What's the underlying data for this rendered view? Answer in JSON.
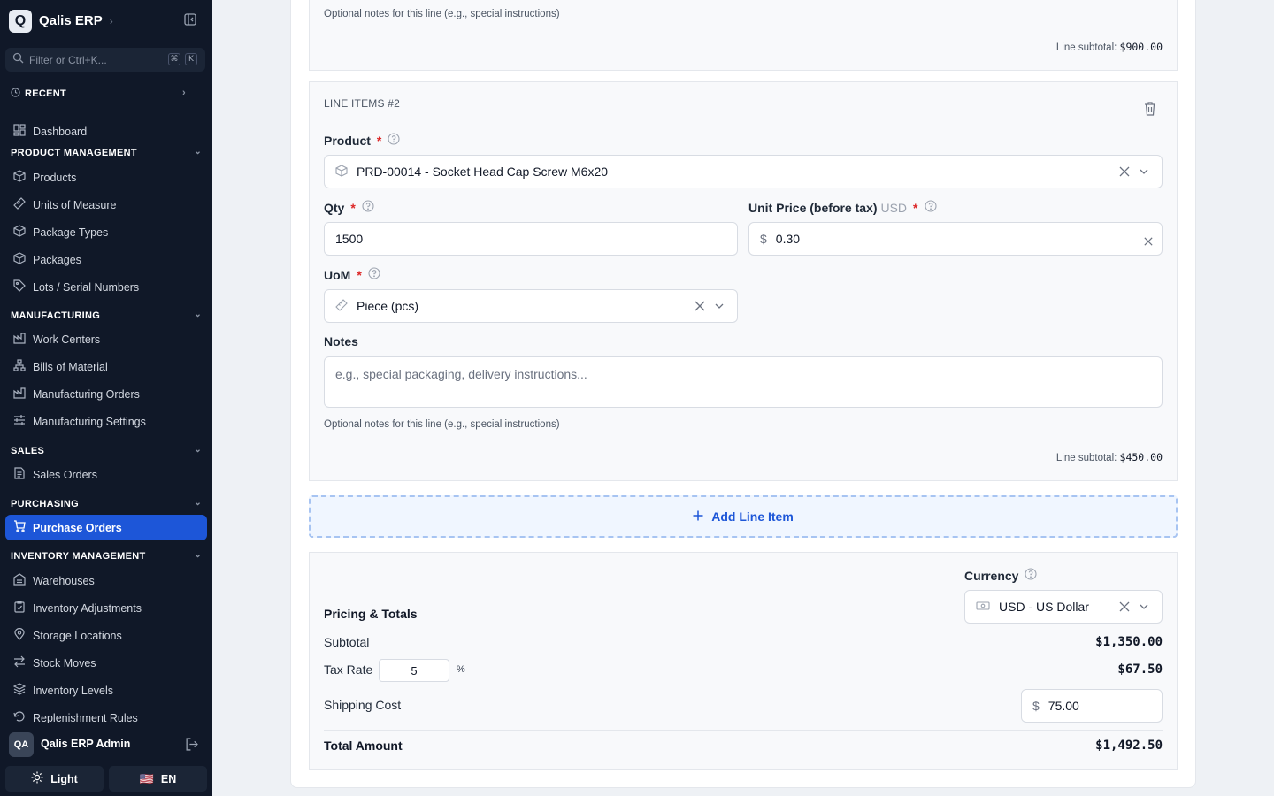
{
  "sidebar": {
    "brand": {
      "logo": "Q",
      "name": "Qalis ERP"
    },
    "filter": {
      "placeholder": "Filter or Ctrl+K...",
      "kbd_1": "⌘",
      "kbd_2": "K"
    },
    "recent_label": "RECENT",
    "dashboard": "Dashboard",
    "sections": {
      "product_management": "PRODUCT MANAGEMENT",
      "manufacturing": "MANUFACTURING",
      "sales": "SALES",
      "purchasing": "PURCHASING",
      "inventory_management": "INVENTORY MANAGEMENT"
    },
    "items": {
      "products": "Products",
      "units_of_measure": "Units of Measure",
      "package_types": "Package Types",
      "packages": "Packages",
      "lots_serial": "Lots / Serial Numbers",
      "work_centers": "Work Centers",
      "bills_of_material": "Bills of Material",
      "manufacturing_orders": "Manufacturing Orders",
      "manufacturing_settings": "Manufacturing Settings",
      "sales_orders": "Sales Orders",
      "purchase_orders": "Purchase Orders",
      "warehouses": "Warehouses",
      "inventory_adjustments": "Inventory Adjustments",
      "storage_locations": "Storage Locations",
      "stock_moves": "Stock Moves",
      "inventory_levels": "Inventory Levels",
      "replenishment_rules": "Replenishment Rules"
    },
    "user": {
      "initials": "QA",
      "name": "Qalis ERP Admin"
    },
    "theme_label": "Light",
    "language_label": "EN",
    "language_flag": "🇺🇸",
    "active_color": "#1d56d8"
  },
  "line1": {
    "notes_helper": "Optional notes for this line (e.g., special instructions)",
    "subtotal_label": "Line subtotal:",
    "subtotal_value": "$900.00"
  },
  "line2": {
    "title": "LINE ITEMS #2",
    "product_label": "Product",
    "product_value": "PRD-00014 - Socket Head Cap Screw M6x20",
    "qty_label": "Qty",
    "qty_value": "1500",
    "price_label": "Unit Price (before tax)",
    "price_currency": "USD",
    "price_symbol": "$",
    "price_value": "0.30",
    "uom_label": "UoM",
    "uom_value": "Piece (pcs)",
    "notes_label": "Notes",
    "notes_placeholder": "e.g., special packaging, delivery instructions...",
    "notes_helper": "Optional notes for this line (e.g., special instructions)",
    "subtotal_label": "Line subtotal:",
    "subtotal_value": "$450.00",
    "required_mark": "*"
  },
  "add_line_label": "Add Line Item",
  "totals": {
    "title": "Pricing & Totals",
    "currency_label": "Currency",
    "currency_value": "USD - US Dollar",
    "subtotal_label": "Subtotal",
    "subtotal_value": "$1,350.00",
    "tax_label": "Tax Rate",
    "tax_rate": "5",
    "tax_percent": "%",
    "tax_value": "$67.50",
    "shipping_label": "Shipping Cost",
    "shipping_symbol": "$",
    "shipping_value": "75.00",
    "total_label": "Total Amount",
    "total_value": "$1,492.50"
  }
}
